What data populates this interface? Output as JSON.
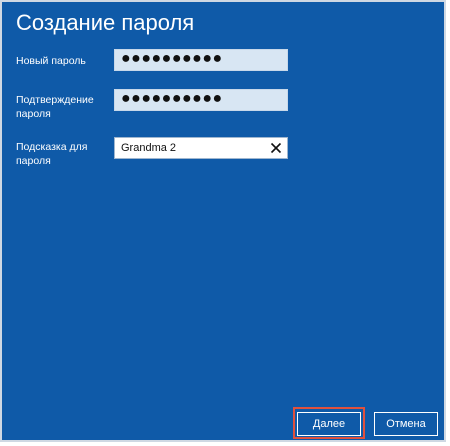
{
  "dialog": {
    "title": "Создание пароля",
    "new_password": {
      "label": "Новый пароль",
      "value": "●●●●●●●●●●"
    },
    "confirm_password": {
      "label_line1": "Подтверждение",
      "label_line2": "пароля",
      "value": "●●●●●●●●●●"
    },
    "password_hint": {
      "label_line1": "Подсказка для",
      "label_line2": "пароля",
      "value": "Grandma 2"
    },
    "buttons": {
      "next": "Далее",
      "cancel": "Отмена"
    },
    "colors": {
      "background": "#0f5aa8",
      "focus_outline": "#e0513d"
    }
  }
}
